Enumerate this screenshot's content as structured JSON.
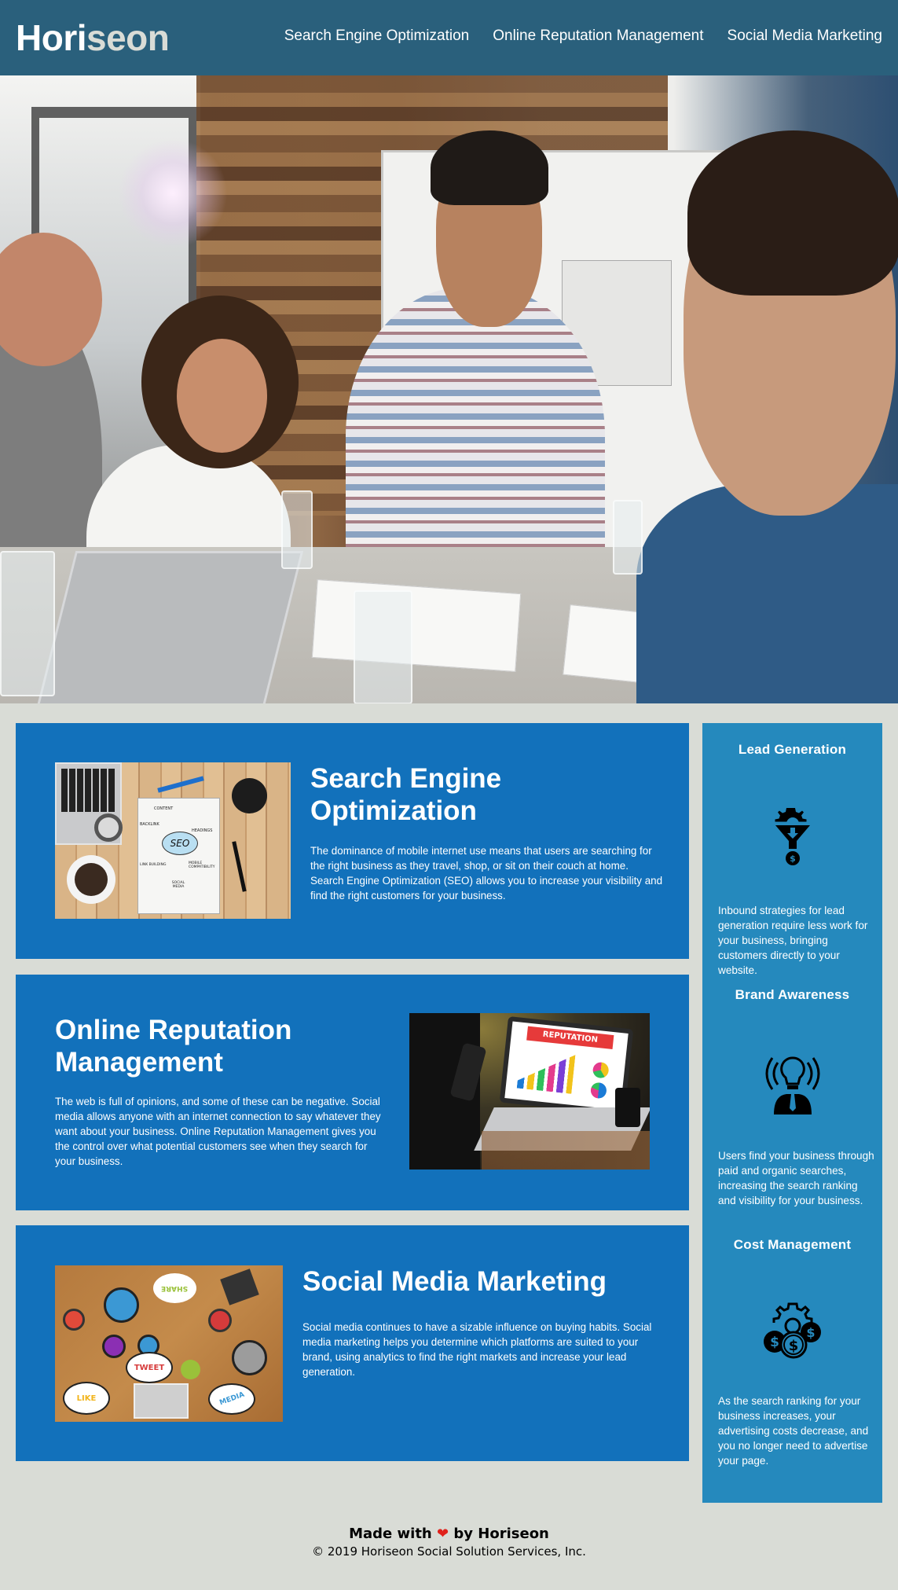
{
  "header": {
    "logo_part1": "Hori",
    "logo_part2": "seon",
    "nav": [
      {
        "label": "Search Engine Optimization"
      },
      {
        "label": "Online Reputation Management"
      },
      {
        "label": "Social Media Marketing"
      }
    ]
  },
  "hero": {
    "image_description": "team-meeting-photo"
  },
  "content": [
    {
      "title": "Search Engine Optimization",
      "text": "The dominance of mobile internet use means that users are searching for the right business as they travel, shop, or sit on their couch at home. Search Engine Optimization (SEO) allows you to increase your visibility and find the right customers for your business.",
      "image_labels": {
        "center": "SEO",
        "top": "CONTENT",
        "left": "BACKLINK",
        "right": "HEADINGS",
        "bottom_left": "LINK BUILDING",
        "bottom_right": "MOBILE COMPATIBILITY",
        "bottom": "SOCIAL MEDIA"
      }
    },
    {
      "title": "Online Reputation Management",
      "text": "The web is full of opinions, and some of these can be negative. Social media allows anyone with an internet connection to say whatever they want about your business. Online Reputation Management gives you the control over what potential customers see when they search for your business.",
      "image_labels": {
        "screen_banner": "REPUTATION"
      }
    },
    {
      "title": "Social Media Marketing",
      "text": "Social media continues to have a sizable influence on buying habits. Social media marketing helps you determine which platforms are suited to your brand, using analytics to find the right markets and increase your lead generation.",
      "image_labels": {
        "share": "SHARE",
        "tweet": "TWEET",
        "like": "LIKE",
        "media": "MEDIA"
      }
    }
  ],
  "benefits": [
    {
      "title": "Lead Generation",
      "icon": "lead-funnel-icon",
      "text": "Inbound strategies for lead generation require less work for your business, bringing customers directly to your website."
    },
    {
      "title": "Brand Awareness",
      "icon": "lightbulb-person-icon",
      "text": "Users find your business through paid and organic searches, increasing the search ranking and visibility for your business."
    },
    {
      "title": "Cost Management",
      "icon": "gear-coins-icon",
      "text": "As the search ranking for your business increases, your advertising costs decrease, and you no longer need to advertise your page."
    }
  ],
  "footer": {
    "made_prefix": "Made with",
    "heart": "❤",
    "made_suffix": "by Horiseon",
    "copyright": "© 2019 Horiseon Social Solution Services, Inc."
  },
  "colors": {
    "header_bg": "#2a607c",
    "page_bg": "#d9dcd6",
    "card_bg": "#1271bb",
    "sidebar_bg": "#2589bd",
    "logo_accent": "#d9dcd6",
    "heart": "#e0211b"
  }
}
